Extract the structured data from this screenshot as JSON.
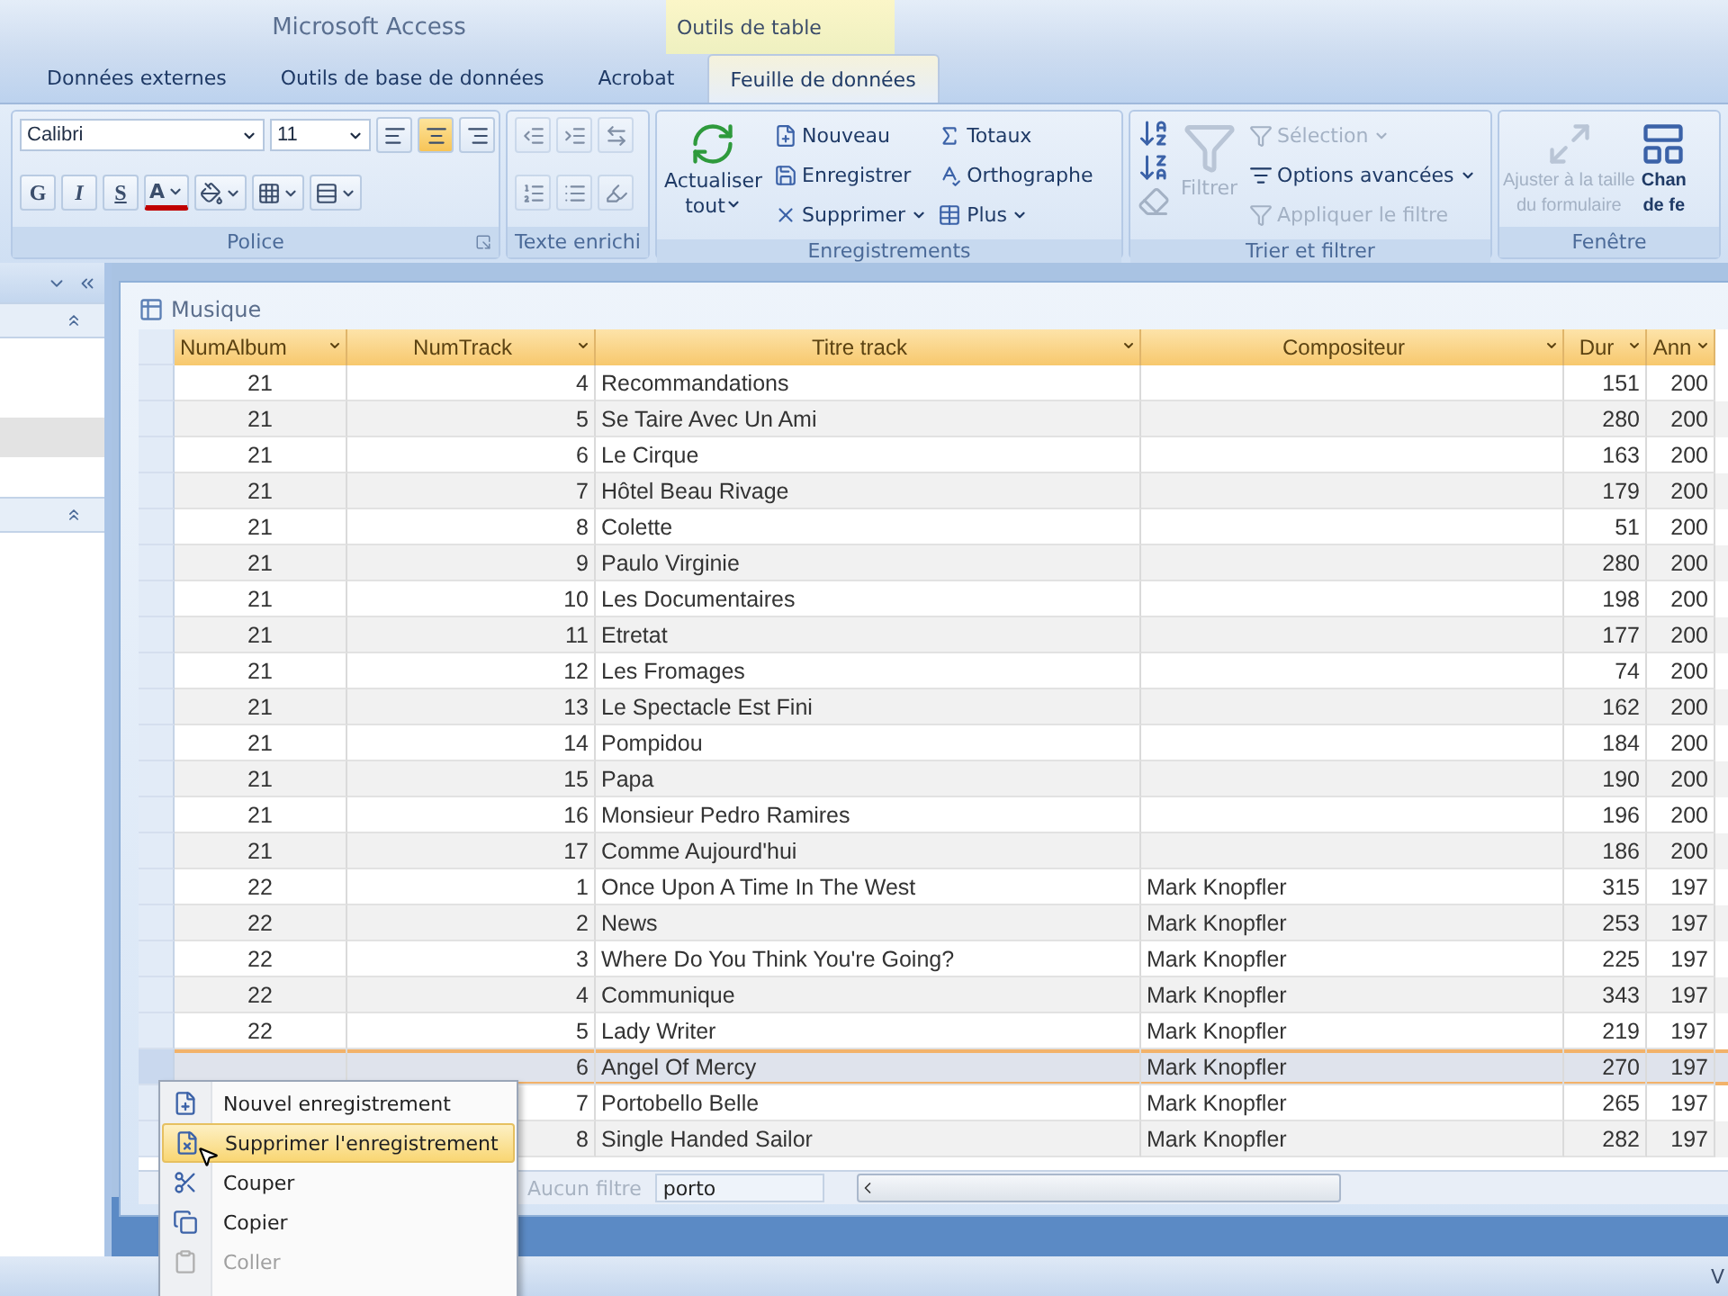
{
  "window": {
    "title": "Microsoft Access",
    "context_tab": "Outils de table"
  },
  "tabs": [
    {
      "label": "Données externes",
      "selected": false
    },
    {
      "label": "Outils de base de données",
      "selected": false
    },
    {
      "label": "Acrobat",
      "selected": false
    },
    {
      "label": "Feuille de données",
      "selected": true
    }
  ],
  "ribbon": {
    "groups": [
      {
        "kind": "font",
        "label": "Police",
        "font": "Calibri",
        "size": "11",
        "align": [
          {
            "selected": false
          },
          {
            "selected": true
          },
          {
            "selected": false
          }
        ],
        "styles": [
          "G",
          "I",
          "S"
        ],
        "color_button": "A"
      },
      {
        "kind": "richtext",
        "label": "Texte enrichi"
      },
      {
        "kind": "records",
        "label": "Enregistrements",
        "large": {
          "label_lines": [
            "Actualiser",
            "tout"
          ],
          "dropdown": true
        },
        "items": [
          {
            "label": "Nouveau",
            "disabled": false,
            "dropdown": false
          },
          {
            "label": "Enregistrer",
            "disabled": false,
            "dropdown": false
          },
          {
            "label": "Supprimer",
            "disabled": false,
            "dropdown": true
          },
          {
            "label": "Totaux",
            "disabled": false,
            "dropdown": false
          },
          {
            "label": "Orthographe",
            "disabled": false,
            "dropdown": false
          },
          {
            "label": "Plus",
            "disabled": false,
            "dropdown": true
          }
        ]
      },
      {
        "kind": "sort",
        "label": "Trier et filtrer",
        "large": {
          "label": "Filtrer",
          "disabled": true
        },
        "items": [
          {
            "label": "Sélection",
            "disabled": true,
            "dropdown": true
          },
          {
            "label": "Options avancées",
            "disabled": false,
            "dropdown": true
          },
          {
            "label": "Appliquer le filtre",
            "disabled": true,
            "dropdown": false
          }
        ]
      },
      {
        "kind": "window",
        "label": "Fenêtre",
        "buttons": [
          {
            "label_lines": [
              "Ajuster à la taille",
              "du formulaire"
            ],
            "disabled": true
          },
          {
            "label_lines": [
              "Chan",
              "de fe"
            ],
            "disabled": false
          }
        ]
      }
    ]
  },
  "document": {
    "title": "Musique",
    "columns": [
      {
        "label": "NumAlbum",
        "kind": "id"
      },
      {
        "label": "NumTrack",
        "kind": "number"
      },
      {
        "label": "Titre track",
        "kind": "text"
      },
      {
        "label": "Compositeur",
        "kind": "text"
      },
      {
        "label": "Dur",
        "kind": "number"
      },
      {
        "label": "Ann",
        "kind": "number"
      }
    ],
    "rows": [
      {
        "cells": [
          "21",
          "4",
          "Recommandations",
          null,
          "151",
          "200"
        ],
        "selected": false
      },
      {
        "cells": [
          "21",
          "5",
          "Se Taire Avec Un Ami",
          null,
          "280",
          "200"
        ],
        "selected": false
      },
      {
        "cells": [
          "21",
          "6",
          "Le Cirque",
          null,
          "163",
          "200"
        ],
        "selected": false
      },
      {
        "cells": [
          "21",
          "7",
          "Hôtel Beau Rivage",
          null,
          "179",
          "200"
        ],
        "selected": false
      },
      {
        "cells": [
          "21",
          "8",
          "Colette",
          null,
          "51",
          "200"
        ],
        "selected": false
      },
      {
        "cells": [
          "21",
          "9",
          "Paulo Virginie",
          null,
          "280",
          "200"
        ],
        "selected": false
      },
      {
        "cells": [
          "21",
          "10",
          "Les Documentaires",
          null,
          "198",
          "200"
        ],
        "selected": false
      },
      {
        "cells": [
          "21",
          "11",
          "Etretat",
          null,
          "177",
          "200"
        ],
        "selected": false
      },
      {
        "cells": [
          "21",
          "12",
          "Les Fromages",
          null,
          "74",
          "200"
        ],
        "selected": false
      },
      {
        "cells": [
          "21",
          "13",
          "Le Spectacle Est Fini",
          null,
          "162",
          "200"
        ],
        "selected": false
      },
      {
        "cells": [
          "21",
          "14",
          "Pompidou",
          null,
          "184",
          "200"
        ],
        "selected": false
      },
      {
        "cells": [
          "21",
          "15",
          "Papa",
          null,
          "190",
          "200"
        ],
        "selected": false
      },
      {
        "cells": [
          "21",
          "16",
          "Monsieur Pedro Ramires",
          null,
          "196",
          "200"
        ],
        "selected": false
      },
      {
        "cells": [
          "21",
          "17",
          "Comme Aujourd'hui",
          null,
          "186",
          "200"
        ],
        "selected": false
      },
      {
        "cells": [
          "22",
          "1",
          "Once Upon A Time In The West",
          "Mark Knopfler",
          "315",
          "197"
        ],
        "selected": false
      },
      {
        "cells": [
          "22",
          "2",
          "News",
          "Mark Knopfler",
          "253",
          "197"
        ],
        "selected": false
      },
      {
        "cells": [
          "22",
          "3",
          "Where Do You Think You're Going?",
          "Mark Knopfler",
          "225",
          "197"
        ],
        "selected": false
      },
      {
        "cells": [
          "22",
          "4",
          "Communique",
          "Mark Knopfler",
          "343",
          "197"
        ],
        "selected": false
      },
      {
        "cells": [
          "22",
          "5",
          "Lady Writer",
          "Mark Knopfler",
          "219",
          "197"
        ],
        "selected": false
      },
      {
        "cells": [
          null,
          "6",
          "Angel Of Mercy",
          "Mark Knopfler",
          "270",
          "197"
        ],
        "selected": true
      },
      {
        "cells": [
          null,
          "7",
          "Portobello Belle",
          "Mark Knopfler",
          "265",
          "197"
        ],
        "selected": false
      },
      {
        "cells": [
          null,
          "8",
          "Single Handed Sailor",
          "Mark Knopfler",
          "282",
          "197"
        ],
        "selected": false
      }
    ],
    "record_bar": {
      "filter": "Aucun filtre",
      "search": "porto"
    }
  },
  "context_menu": {
    "items": [
      {
        "label": "Nouvel enregistrement",
        "selected": false,
        "disabled": false
      },
      {
        "label": "Supprimer l'enregistrement",
        "selected": true,
        "disabled": false
      },
      {
        "label": "Couper",
        "selected": false,
        "disabled": false
      },
      {
        "label": "Copier",
        "selected": false,
        "disabled": false
      },
      {
        "label": "Coller",
        "selected": false,
        "disabled": true
      }
    ]
  },
  "status_bar": {
    "text": "V"
  }
}
